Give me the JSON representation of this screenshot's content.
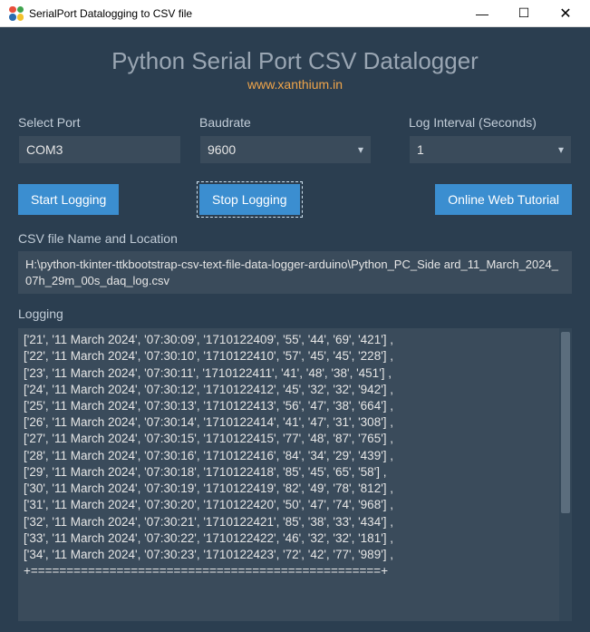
{
  "window": {
    "title": "SerialPort Datalogging to CSV file"
  },
  "header": {
    "title": "Python Serial Port CSV Datalogger",
    "subtitle": "www.xanthium.in"
  },
  "controls": {
    "port_label": "Select Port",
    "port_value": "COM3",
    "baud_label": "Baudrate",
    "baud_value": "9600",
    "interval_label": "Log Interval (Seconds)",
    "interval_value": "1"
  },
  "buttons": {
    "start": "Start Logging",
    "stop": "Stop Logging",
    "tutorial": "Online Web Tutorial"
  },
  "csv_section": {
    "label": "CSV file Name and Location",
    "path": "H:\\python-tkinter-ttkbootstrap-csv-text-file-data-logger-arduino\\Python_PC_Side ard_11_March_2024_07h_29m_00s_daq_log.csv"
  },
  "log_section": {
    "label": "Logging",
    "rows": [
      [
        "21",
        "11 March 2024",
        "07:30:09",
        "1710122409",
        "55",
        "44",
        "69",
        "421"
      ],
      [
        "22",
        "11 March 2024",
        "07:30:10",
        "1710122410",
        "57",
        "45",
        "45",
        "228"
      ],
      [
        "23",
        "11 March 2024",
        "07:30:11",
        "1710122411",
        "41",
        "48",
        "38",
        "451"
      ],
      [
        "24",
        "11 March 2024",
        "07:30:12",
        "1710122412",
        "45",
        "32",
        "32",
        "942"
      ],
      [
        "25",
        "11 March 2024",
        "07:30:13",
        "1710122413",
        "56",
        "47",
        "38",
        "664"
      ],
      [
        "26",
        "11 March 2024",
        "07:30:14",
        "1710122414",
        "41",
        "47",
        "31",
        "308"
      ],
      [
        "27",
        "11 March 2024",
        "07:30:15",
        "1710122415",
        "77",
        "48",
        "87",
        "765"
      ],
      [
        "28",
        "11 March 2024",
        "07:30:16",
        "1710122416",
        "84",
        "34",
        "29",
        "439"
      ],
      [
        "29",
        "11 March 2024",
        "07:30:18",
        "1710122418",
        "85",
        "45",
        "65",
        "58"
      ],
      [
        "30",
        "11 March 2024",
        "07:30:19",
        "1710122419",
        "82",
        "49",
        "78",
        "812"
      ],
      [
        "31",
        "11 March 2024",
        "07:30:20",
        "1710122420",
        "50",
        "47",
        "74",
        "968"
      ],
      [
        "32",
        "11 March 2024",
        "07:30:21",
        "1710122421",
        "85",
        "38",
        "33",
        "434"
      ],
      [
        "33",
        "11 March 2024",
        "07:30:22",
        "1710122422",
        "46",
        "32",
        "32",
        "181"
      ],
      [
        "34",
        "11 March 2024",
        "07:30:23",
        "1710122423",
        "72",
        "42",
        "77",
        "989"
      ]
    ],
    "terminator": "+=================================================+"
  },
  "icon_colors": [
    "#e94e3b",
    "#3fa34d",
    "#2b6cb0",
    "#f3c12b"
  ]
}
